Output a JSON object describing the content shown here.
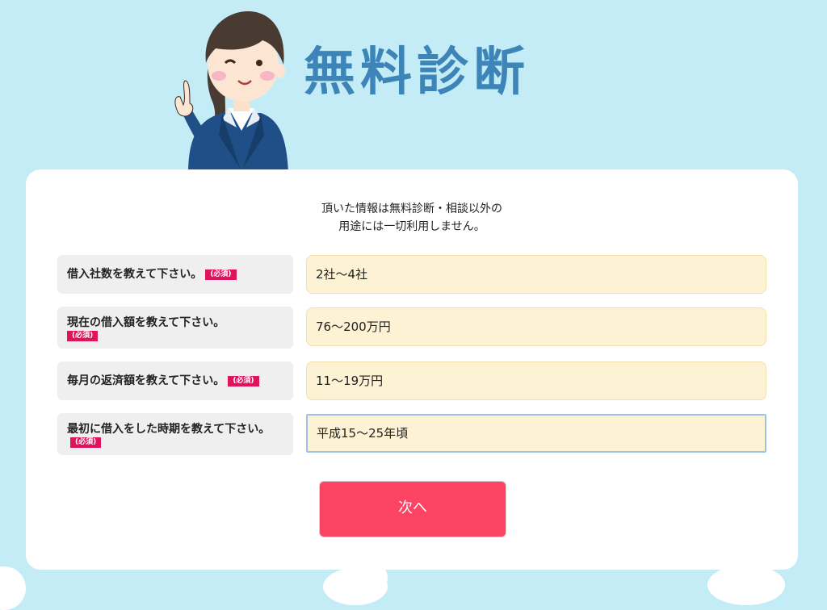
{
  "header": {
    "title": "無料診断"
  },
  "notice": {
    "line1": "頂いた情報は無料診断・相談以外の",
    "line2": "用途には一切利用しません。"
  },
  "form": {
    "required_badge": "(必須)",
    "questions": [
      {
        "label": "借入社数を教えて下さい。",
        "value": "2社〜4社"
      },
      {
        "label": "現在の借入額を教えて下さい。",
        "value": "76〜200万円"
      },
      {
        "label": "毎月の返済額を教えて下さい。",
        "value": "11〜19万円"
      },
      {
        "label": "最初に借入をした時期を教えて下さい。",
        "value": "平成15〜25年頃"
      }
    ],
    "next_label": "次へ"
  },
  "colors": {
    "background": "#c4ecf6",
    "title": "#3d84b8",
    "required_badge": "#e0145c",
    "field_bg": "#fdf2d4",
    "button": "#fb4463"
  }
}
